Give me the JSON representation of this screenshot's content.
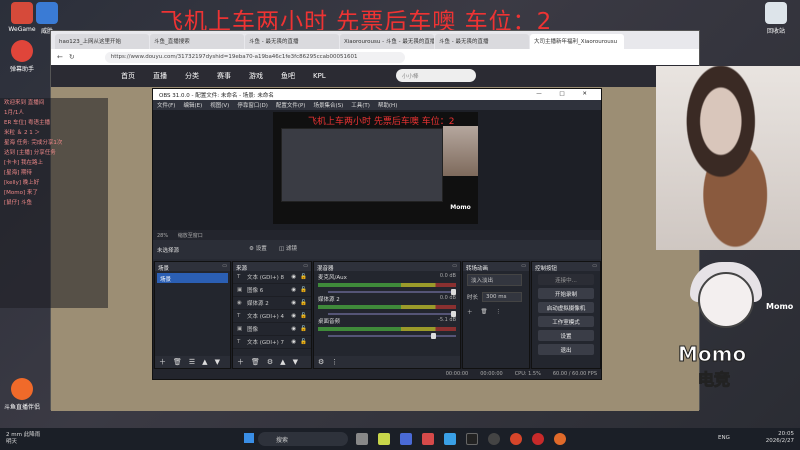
{
  "overlay": {
    "title": "飞机上车两小时  先票后车噢 车位：2"
  },
  "desktop": {
    "icons": [
      {
        "label": "WeGame",
        "color": "#d64a3a"
      },
      {
        "label": "威胜",
        "color": "#3a7bd5"
      },
      {
        "label": "弹幕助手",
        "color": "#e0453a"
      },
      {
        "label": "斗鱼直播伴侣",
        "color": "#f06a2a"
      },
      {
        "label": "回收站",
        "color": "#dde4ea"
      }
    ]
  },
  "browser": {
    "tabs": [
      "hao123_上网从这里开始",
      "斗鱼_直播搜索",
      "斗鱼 - 最无畏的直播",
      "Xiaorourousu - 斗鱼 - 最无畏的直播",
      "斗鱼 - 最无畏的直播",
      "大司主播新年福利_Xiaorourousu"
    ],
    "url": "https://www.douyu.com/31732197dyshid=19eba70-a19ba46c1fe3fc86295ccab00051601",
    "nav": [
      "首页",
      "直播",
      "分类",
      "赛事",
      "游戏",
      "鱼吧",
      "KPL"
    ],
    "search_placeholder": "小小棒"
  },
  "obs": {
    "title": "OBS 31.0.0 - 配置文件: 未命名 - 场景: 未命名",
    "window_controls": "— □ ✕",
    "menu": [
      "文件(F)",
      "编辑(E)",
      "视图(V)",
      "停靠窗口(D)",
      "配置文件(P)",
      "场景集合(S)",
      "工具(T)",
      "帮助(H)"
    ],
    "preview_title": "飞机上车两小时  先票后车噢 车位：2",
    "preview_momo": "Momo",
    "zoom": "28%",
    "preview_toolbar": "缩放至窗口",
    "scene_bar": {
      "label": "未选择源",
      "settings": "设置",
      "filters": "滤镜"
    },
    "scenes": {
      "header": "场景",
      "items": [
        "场景"
      ]
    },
    "sources": {
      "header": "来源",
      "items": [
        {
          "icon": "T",
          "name": "文本 (GDI+) 8"
        },
        {
          "icon": "▣",
          "name": "图像 6"
        },
        {
          "icon": "◉",
          "name": "媒体源 2"
        },
        {
          "icon": "T",
          "name": "文本 (GDI+) 4"
        },
        {
          "icon": "▣",
          "name": "图像"
        },
        {
          "icon": "T",
          "name": "文本 (GDI+) 7"
        }
      ]
    },
    "mixer": {
      "header": "混音器",
      "channels": [
        {
          "name": "麦克风/Aux",
          "db": "0.0 dB"
        },
        {
          "name": "媒体源 2",
          "db": "0.0 dB"
        },
        {
          "name": "桌面音频",
          "db": "-5.1 dB"
        }
      ]
    },
    "transitions": {
      "header": "转场动画",
      "type": "淡入淡出",
      "duration_label": "时长",
      "duration": "300 ms"
    },
    "controls": {
      "header": "控制按钮",
      "buttons": [
        "连接中...",
        "开始录制",
        "启动虚拟摄像机",
        "工作室模式",
        "设置",
        "退出"
      ]
    },
    "status": {
      "dropped": "00:00:00",
      "rec": "00:00:00",
      "cpu": "CPU: 1.5%",
      "fps": "60.00 / 60.00 FPS"
    }
  },
  "chat": {
    "lines": [
      "欢迎来到 直播间",
      "1月/1人",
      "ER 车位] 粤语主播",
      "米粒 ＆ 2 1 ＞",
      "星海 任务: 完成分享1次",
      "达到 [主播] 分享任务",
      "[卡卡] 我在路上",
      "[星海] 期待",
      "[kelly] 晚上好",
      "[Momo] 来了",
      "[鼠仔] 斗鱼"
    ]
  },
  "right": {
    "momo_label": "Momo",
    "momo_text": "Momo",
    "momo_sub": "电竞"
  },
  "taskbar": {
    "weather_temp": "2 mm 此降雨",
    "weather_desc": "明天",
    "search": "搜索",
    "lang": "ENG",
    "time": "20:05",
    "date": "2026/2/27"
  }
}
